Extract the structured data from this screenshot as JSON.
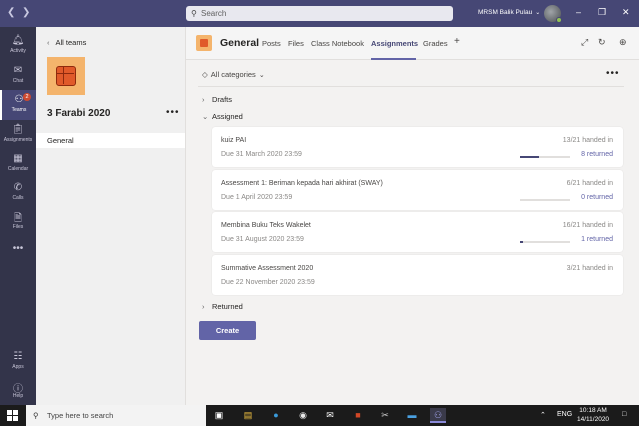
{
  "titlebar": {
    "search_placeholder": "Search",
    "tenant": "MRSM Balik Pulau"
  },
  "rail": {
    "items": [
      {
        "label": "Activity",
        "icon": "bell-icon"
      },
      {
        "label": "Chat",
        "icon": "chat-icon"
      },
      {
        "label": "Teams",
        "icon": "teams-icon",
        "badge": "2"
      },
      {
        "label": "Assignments",
        "icon": "assignments-icon"
      },
      {
        "label": "Calendar",
        "icon": "calendar-icon"
      },
      {
        "label": "Calls",
        "icon": "phone-icon"
      },
      {
        "label": "Files",
        "icon": "files-icon"
      },
      {
        "label": "Apps",
        "icon": "apps-icon"
      },
      {
        "label": "Help",
        "icon": "help-icon"
      }
    ]
  },
  "team_panel": {
    "back_label": "All teams",
    "team_name": "3 Farabi 2020",
    "channel": "General"
  },
  "header": {
    "channel_title": "General",
    "tabs": [
      "Posts",
      "Files",
      "Class Notebook",
      "Assignments",
      "Grades"
    ],
    "active_tab": "Assignments"
  },
  "filters": {
    "category": "All categories"
  },
  "sections": {
    "drafts": "Drafts",
    "assigned": "Assigned",
    "returned": "Returned"
  },
  "assignments": [
    {
      "title": "kuiz PAI",
      "due": "Due 31 March 2020 23:59",
      "handed": "13/21 handed in",
      "progress": 0.38,
      "returned": "8 returned"
    },
    {
      "title": "Assessment 1: Beriman kepada hari akhirat (SWAY)",
      "due": "Due 1 April 2020 23:59",
      "handed": "6/21 handed in",
      "progress": 0.0,
      "returned": "0 returned"
    },
    {
      "title": "Membina Buku Teks Wakelet",
      "due": "Due 31 August 2020 23:59",
      "handed": "16/21 handed in",
      "progress": 0.06,
      "returned": "1 returned"
    },
    {
      "title": "Summative Assessment 2020",
      "due": "Due 22 November 2020 23:59",
      "handed": "3/21 handed in",
      "progress": null,
      "returned": ""
    }
  ],
  "create_label": "Create",
  "taskbar": {
    "search_placeholder": "Type here to search",
    "language": "ENG",
    "time": "10:18 AM",
    "date": "14/11/2020"
  },
  "colors": {
    "brand": "#464775",
    "accent": "#6264a7",
    "rail": "#33344a"
  }
}
